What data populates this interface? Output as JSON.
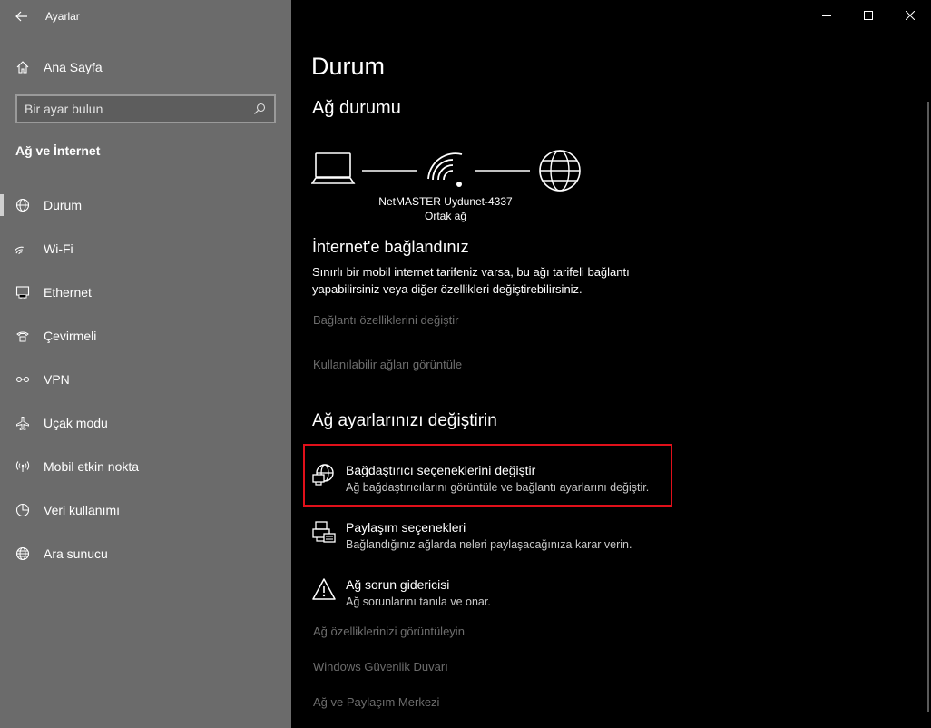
{
  "window": {
    "app_title": "Ayarlar"
  },
  "sidebar": {
    "home_label": "Ana Sayfa",
    "search_placeholder": "Bir ayar bulun",
    "section_title": "Ağ ve İnternet",
    "items": [
      {
        "label": "Durum",
        "icon": "globe-icon",
        "active": true
      },
      {
        "label": "Wi-Fi",
        "icon": "wifi-icon"
      },
      {
        "label": "Ethernet",
        "icon": "ethernet-icon"
      },
      {
        "label": "Çevirmeli",
        "icon": "dialup-icon"
      },
      {
        "label": "VPN",
        "icon": "vpn-icon"
      },
      {
        "label": "Uçak modu",
        "icon": "airplane-icon"
      },
      {
        "label": "Mobil etkin nokta",
        "icon": "hotspot-icon"
      },
      {
        "label": "Veri kullanımı",
        "icon": "data-usage-icon"
      },
      {
        "label": "Ara sunucu",
        "icon": "proxy-icon"
      }
    ]
  },
  "main": {
    "page_title": "Durum",
    "network_status_title": "Ağ durumu",
    "network_name": "NetMASTER Uydunet-4337",
    "network_type": "Ortak ağ",
    "connected_title": "İnternet'e bağlandınız",
    "connected_desc": "Sınırlı bir mobil internet tarifeniz varsa, bu ağı tarifeli bağlantı yapabilirsiniz veya diğer özellikleri değiştirebilirsiniz.",
    "link_change_properties": "Bağlantı özelliklerini değiştir",
    "link_show_networks": "Kullanılabilir ağları görüntüle",
    "change_settings_title": "Ağ ayarlarınızı değiştirin",
    "options": [
      {
        "title": "Bağdaştırıcı seçeneklerini değiştir",
        "desc": "Ağ bağdaştırıcılarını görüntüle ve bağlantı ayarlarını değiştir."
      },
      {
        "title": "Paylaşım seçenekleri",
        "desc": "Bağlandığınız ağlarda neleri paylaşacağınıza karar verin."
      },
      {
        "title": "Ağ sorun gidericisi",
        "desc": "Ağ sorunlarını tanıla ve onar."
      }
    ],
    "link_view_properties": "Ağ özelliklerinizi görüntüleyin",
    "link_firewall": "Windows Güvenlik Duvarı",
    "link_sharing_center": "Ağ ve Paylaşım Merkezi"
  },
  "colors": {
    "sidebar_bg": "#6b6b6b",
    "main_bg": "#000000",
    "highlight": "#e0101a",
    "disabled_link": "#6d6d6d"
  }
}
